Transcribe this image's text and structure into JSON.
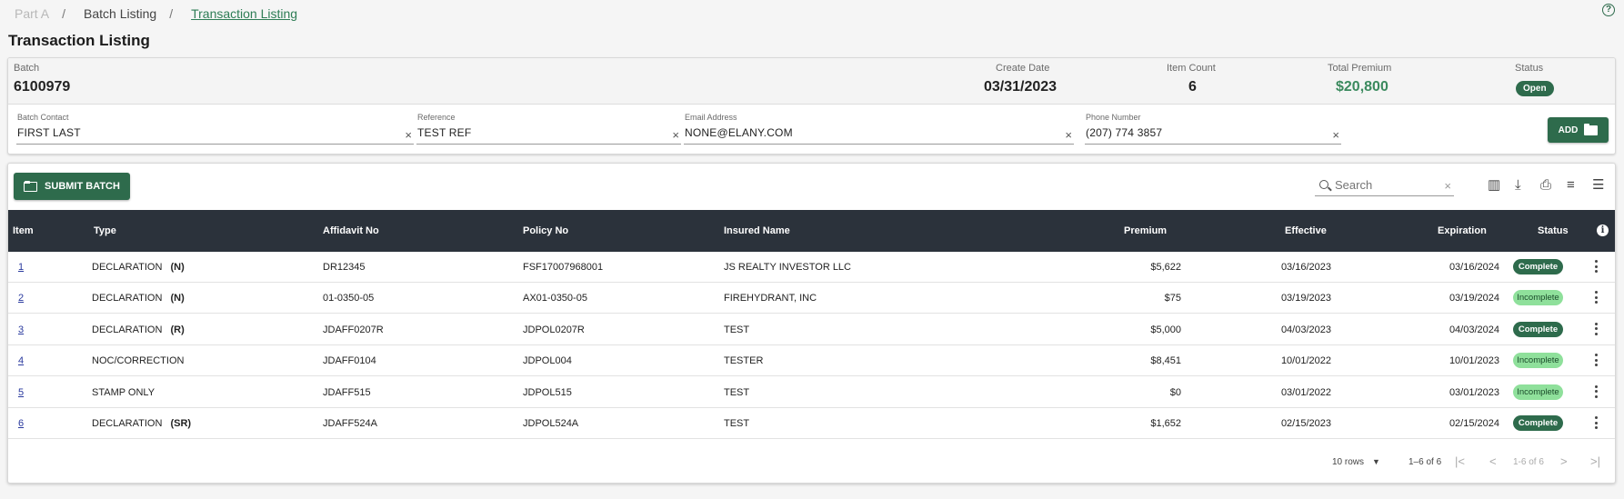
{
  "breadcrumb": {
    "part": "Part A",
    "batch_listing": "Batch Listing",
    "transaction_listing": "Transaction Listing"
  },
  "help_icon": "?",
  "page_title": "Transaction Listing",
  "batch": {
    "batch_label": "Batch",
    "batch_value": "6100979",
    "create_date_label": "Create Date",
    "create_date_value": "03/31/2023",
    "item_count_label": "Item Count",
    "item_count_value": "6",
    "total_premium_label": "Total Premium",
    "total_premium_value": "$20,800",
    "status_label": "Status",
    "status_value": "Open"
  },
  "fields": {
    "contact_label": "Batch Contact",
    "contact_value": "FIRST LAST",
    "reference_label": "Reference",
    "reference_value": "TEST REF",
    "email_label": "Email Address",
    "email_value": "NONE@ELANY.COM",
    "phone_label": "Phone Number",
    "phone_value": "(207) 774 3857",
    "clear_glyph": "×"
  },
  "add_button": "ADD",
  "toolbar": {
    "submit_label": "SUBMIT BATCH",
    "search_placeholder": "Search",
    "clear_glyph": "×"
  },
  "table": {
    "headers": {
      "item": "Item",
      "type": "Type",
      "affidavit": "Affidavit No",
      "policy": "Policy No",
      "insured": "Insured Name",
      "premium": "Premium",
      "effective": "Effective",
      "expiration": "Expiration",
      "status": "Status"
    },
    "rows": [
      {
        "item": "1",
        "type": "DECLARATION",
        "code": "(N)",
        "affidavit": "DR12345",
        "policy": "FSF17007968001",
        "insured": "JS REALTY INVESTOR LLC",
        "premium": "$5,622",
        "effective": "03/16/2023",
        "expiration": "03/16/2024",
        "status": "Complete"
      },
      {
        "item": "2",
        "type": "DECLARATION",
        "code": "(N)",
        "affidavit": "01-0350-05",
        "policy": "AX01-0350-05",
        "insured": "FIREHYDRANT, INC",
        "premium": "$75",
        "effective": "03/19/2023",
        "expiration": "03/19/2024",
        "status": "Incomplete"
      },
      {
        "item": "3",
        "type": "DECLARATION",
        "code": "(R)",
        "affidavit": "JDAFF0207R",
        "policy": "JDPOL0207R",
        "insured": "TEST",
        "premium": "$5,000",
        "effective": "04/03/2023",
        "expiration": "04/03/2024",
        "status": "Complete"
      },
      {
        "item": "4",
        "type": "NOC/CORRECTION",
        "code": "",
        "affidavit": "JDAFF0104",
        "policy": "JDPOL004",
        "insured": "TESTER",
        "premium": "$8,451",
        "effective": "10/01/2022",
        "expiration": "10/01/2023",
        "status": "Incomplete"
      },
      {
        "item": "5",
        "type": "STAMP ONLY",
        "code": "",
        "affidavit": "JDAFF515",
        "policy": "JDPOL515",
        "insured": "TEST",
        "premium": "$0",
        "effective": "03/01/2022",
        "expiration": "03/01/2023",
        "status": "Incomplete"
      },
      {
        "item": "6",
        "type": "DECLARATION",
        "code": "(SR)",
        "affidavit": "JDAFF524A",
        "policy": "JDPOL524A",
        "insured": "TEST",
        "premium": "$1,652",
        "effective": "02/15/2023",
        "expiration": "02/15/2024",
        "status": "Complete"
      }
    ]
  },
  "pagination": {
    "rows_per_page": "10 rows",
    "range": "1–6 of 6",
    "range_small": "1-6 of 6"
  },
  "colors": {
    "brand_green": "#2e6b4c",
    "header_dark": "#2b323b",
    "incomplete_green": "#8fe09b"
  }
}
